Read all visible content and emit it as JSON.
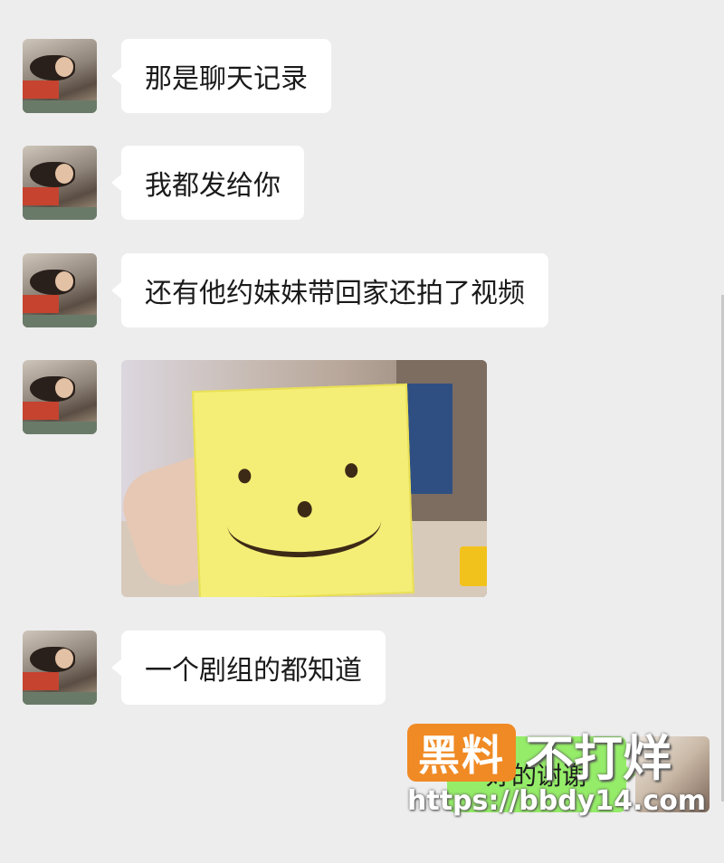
{
  "messages": [
    {
      "text": "那是聊天记录"
    },
    {
      "text": "我都发给你"
    },
    {
      "text": "还有他约妹妹带回家还拍了视频"
    },
    {
      "text": "一个剧组的都知道"
    }
  ],
  "image_message": {
    "content": "photo-with-smiley-sticker"
  },
  "my_message": {
    "text": "好的谢谢"
  },
  "watermark": {
    "logo": "黑料",
    "title": "不打烊",
    "url": "https://bbdy14.com"
  },
  "colors": {
    "background": "#ededed",
    "incoming_bubble": "#ffffff",
    "outgoing_bubble": "#95ec69",
    "watermark_logo": "#f08a24"
  }
}
